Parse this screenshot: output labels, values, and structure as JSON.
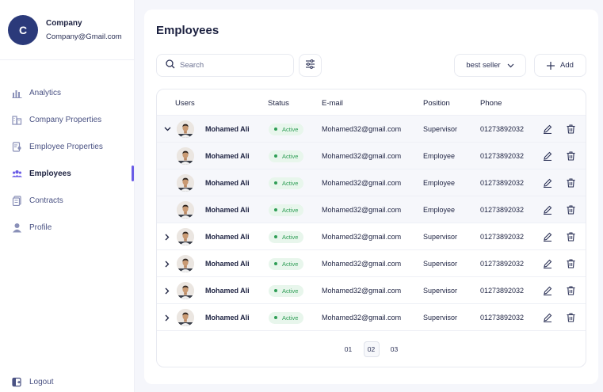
{
  "profile": {
    "initial": "C",
    "name": "Company",
    "email": "Company@Gmail.com"
  },
  "sidebar": {
    "items": [
      {
        "label": "Analytics",
        "icon": "chart-bars-icon",
        "active": false
      },
      {
        "label": "Company Properties",
        "icon": "buildings-icon",
        "active": false
      },
      {
        "label": "Employee Properties",
        "icon": "document-user-icon",
        "active": false
      },
      {
        "label": "Employees",
        "icon": "users-group-icon",
        "active": true
      },
      {
        "label": "Contracts",
        "icon": "documents-icon",
        "active": false
      },
      {
        "label": "Profile",
        "icon": "user-icon",
        "active": false
      }
    ],
    "logout_label": "Logout"
  },
  "main": {
    "title": "Employees",
    "search": {
      "placeholder": "Search",
      "value": ""
    },
    "sort": {
      "selected": "best seller"
    },
    "add_label": "Add"
  },
  "table": {
    "headers": {
      "users": "Users",
      "status": "Status",
      "email": "E-mail",
      "position": "Position",
      "phone": "Phone"
    },
    "rows": [
      {
        "name": "Mohamed Ali",
        "status": "Active",
        "email": "Mohamed32@gmail.com",
        "position": "Supervisor",
        "phone": "01273892032",
        "toggle": "expanded"
      },
      {
        "name": "Mohamed Ali",
        "status": "Active",
        "email": "Mohamed32@gmail.com",
        "position": "Employee",
        "phone": "01273892032",
        "toggle": "none"
      },
      {
        "name": "Mohamed Ali",
        "status": "Active",
        "email": "Mohamed32@gmail.com",
        "position": "Employee",
        "phone": "01273892032",
        "toggle": "none"
      },
      {
        "name": "Mohamed Ali",
        "status": "Active",
        "email": "Mohamed32@gmail.com",
        "position": "Employee",
        "phone": "01273892032",
        "toggle": "none"
      },
      {
        "name": "Mohamed Ali",
        "status": "Active",
        "email": "Mohamed32@gmail.com",
        "position": "Supervisor",
        "phone": "01273892032",
        "toggle": "collapsed"
      },
      {
        "name": "Mohamed Ali",
        "status": "Active",
        "email": "Mohamed32@gmail.com",
        "position": "Supervisor",
        "phone": "01273892032",
        "toggle": "collapsed"
      },
      {
        "name": "Mohamed Ali",
        "status": "Active",
        "email": "Mohamed32@gmail.com",
        "position": "Supervisor",
        "phone": "01273892032",
        "toggle": "collapsed"
      },
      {
        "name": "Mohamed Ali",
        "status": "Active",
        "email": "Mohamed32@gmail.com",
        "position": "Supervisor",
        "phone": "01273892032",
        "toggle": "collapsed"
      }
    ]
  },
  "pagination": {
    "pages": [
      "01",
      "02",
      "03"
    ],
    "current": "02"
  },
  "colors": {
    "accent": "#6a5ce6",
    "status_active": "#2f9e56",
    "status_bg": "#e8f6ec",
    "navy": "#1c2140"
  }
}
